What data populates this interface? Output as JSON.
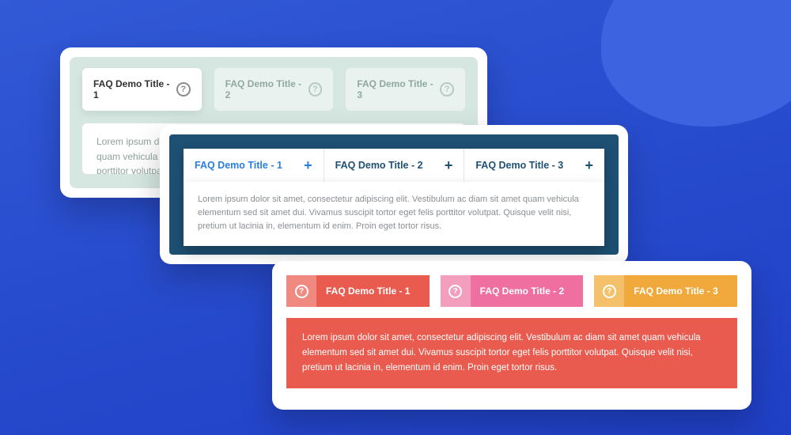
{
  "card1": {
    "tabs": [
      {
        "label": "FAQ Demo Title - 1"
      },
      {
        "label": "FAQ Demo Title - 2"
      },
      {
        "label": "FAQ Demo Title - 3"
      }
    ],
    "body": "Lorem ipsum dolor sit amet, consectetur adipiscing elit. Vestibulum ac diam sit amet quam vehicula elementum sed sit amet dui. Vivamus suscipit tortor eget felis porttitor volutpat. Quisque velit nisi, pretium ut lacinia in, elementum id enim. Proin eget tortor risus."
  },
  "card2": {
    "tabs": [
      {
        "label": "FAQ Demo Title - 1"
      },
      {
        "label": "FAQ Demo Title - 2"
      },
      {
        "label": "FAQ Demo Title - 3"
      }
    ],
    "body": "Lorem ipsum dolor sit amet, consectetur adipiscing elit. Vestibulum ac diam sit amet quam vehicula elementum sed sit amet dui. Vivamus suscipit tortor eget felis porttitor volutpat. Quisque velit nisi, pretium ut lacinia in, elementum id enim. Proin eget tortor risus."
  },
  "card3": {
    "tabs": [
      {
        "label": "FAQ Demo Title - 1"
      },
      {
        "label": "FAQ Demo Title - 2"
      },
      {
        "label": "FAQ Demo Title - 3"
      }
    ],
    "body": "Lorem ipsum dolor sit amet, consectetur adipiscing elit. Vestibulum ac diam sit amet quam vehicula elementum sed sit amet dui. Vivamus suscipit tortor eget felis porttitor volutpat. Quisque velit nisi, pretium ut lacinia in, elementum id enim. Proin eget tortor risus."
  }
}
